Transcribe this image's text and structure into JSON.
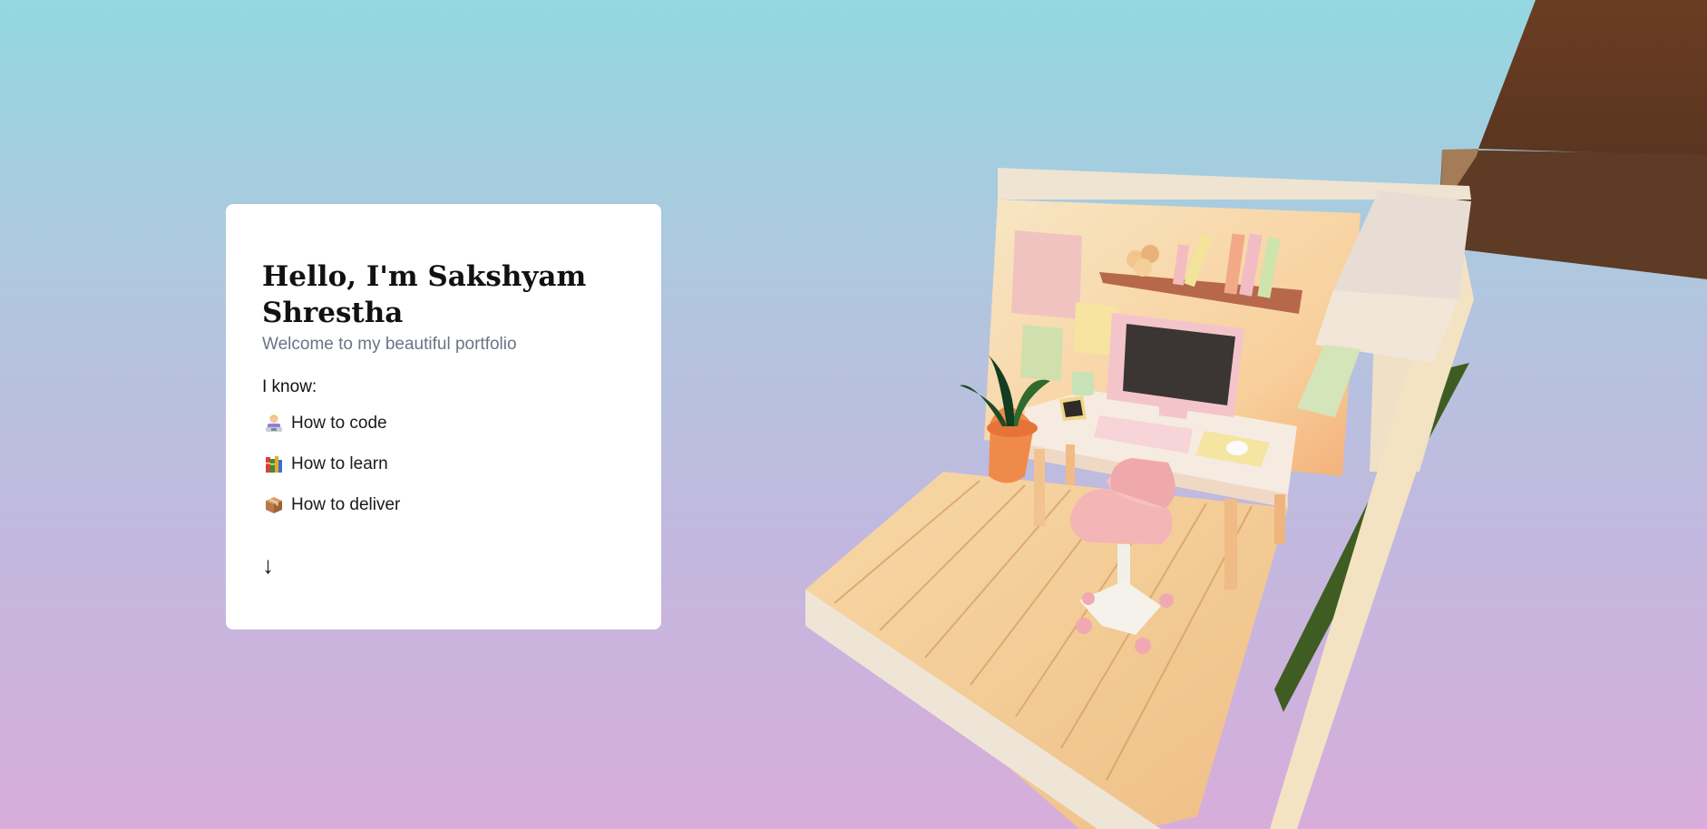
{
  "intro": {
    "title": "Hello, I'm Sakshyam Shrestha",
    "subtitle": "Welcome to my beautiful portfolio",
    "know_label": "I know:",
    "skills": [
      {
        "icon": "technologist-icon",
        "label": "How to code"
      },
      {
        "icon": "books-icon",
        "label": "How to learn"
      },
      {
        "icon": "package-icon",
        "label": "How to deliver"
      }
    ],
    "scroll_arrow": "↓"
  },
  "colors": {
    "background_top": "#93d8e0",
    "background_bottom": "#d8addb",
    "card": "#ffffff",
    "subtitle": "#6b7485"
  }
}
